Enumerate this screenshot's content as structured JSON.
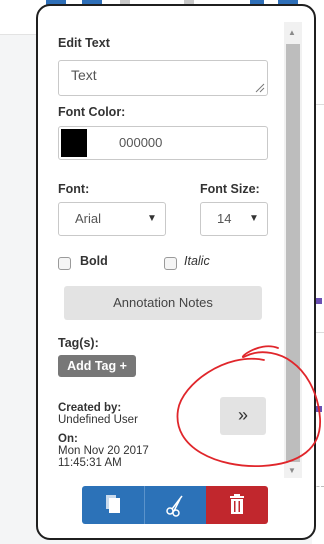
{
  "popup": {
    "edit_text_label": "Edit Text",
    "edit_text_value": "Text",
    "font_color_label": "Font Color:",
    "font_color_value": "000000",
    "font_label": "Font:",
    "font_size_label": "Font Size:",
    "font_value": "Arial",
    "font_size_value": "14",
    "bold_label": "Bold",
    "italic_label": "Italic",
    "annotation_notes_label": "Annotation Notes",
    "tags_label": "Tag(s):",
    "add_tag_label": "Add Tag +",
    "created_by_label": "Created by:",
    "created_by_value": "Undefined User",
    "on_label": "On:",
    "date_value": "Mon Nov 20 2017",
    "time_value": "11:45:31 AM",
    "expand_label": "»"
  },
  "actions": {
    "copy_icon": "copy-icon",
    "cut_icon": "scissors-icon",
    "delete_icon": "trash-icon"
  },
  "colors": {
    "font_color": "#000000",
    "blue": "#2c72b8",
    "red": "#c1272d",
    "annotation": "#e0262b"
  }
}
